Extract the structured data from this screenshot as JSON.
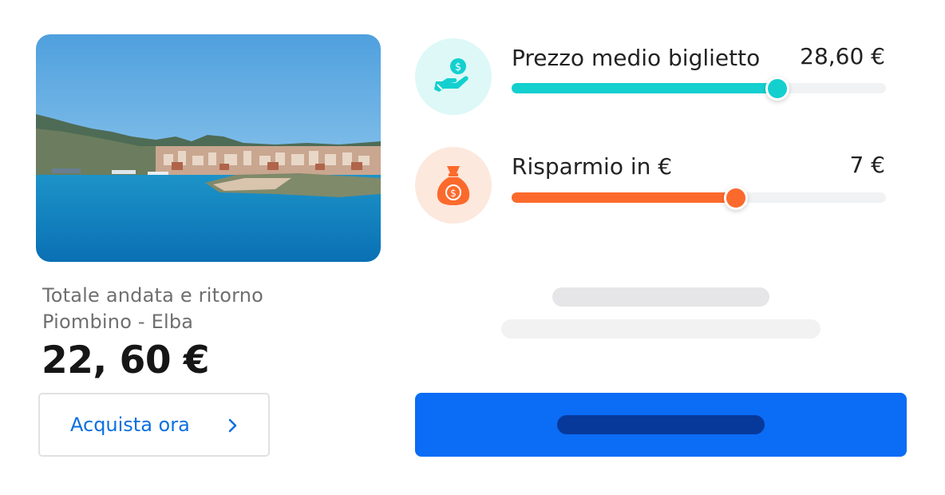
{
  "destination": {
    "route_caption": "Totale andata e ritorno",
    "route": "Piombino - Elba",
    "total_price": "22, 60 €",
    "buy_label": "Acquista ora"
  },
  "stats": [
    {
      "title": "Prezzo medio biglietto",
      "value": "28,60 €",
      "level_percent": 71,
      "accent": "#13d0cf",
      "icon": "hand-coin-icon"
    },
    {
      "title": "Risparmio in €",
      "value": "7 €",
      "level_percent": 60,
      "accent": "#fb6a2c",
      "icon": "money-bag-icon"
    }
  ],
  "colors": {
    "primary_button": "#0b6cf6",
    "link": "#0b6fde"
  }
}
